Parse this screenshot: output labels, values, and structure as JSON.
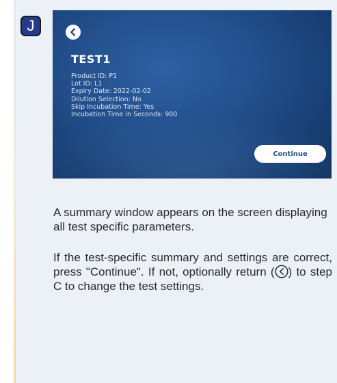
{
  "step": {
    "label": "J"
  },
  "screen": {
    "title": "TEST1",
    "params": [
      "Product ID: P1",
      "Lot ID: L1",
      "Expiry Date: 2022-02-02",
      "Dilution Selection: No",
      "Skip Incubation Time: Yes",
      "Incubation Time in Seconds:  900"
    ],
    "continue_label": "Continue",
    "back_icon": "chevron-left-icon"
  },
  "description": {
    "paragraph1": "A summary window appears on the screen displaying all test specific parameters.",
    "paragraph2_before_icon": "If the test-specific summary and settings are correct, press \"Continue\". If not, optionally return (",
    "paragraph2_after_icon": ") to step C to change the test settings.",
    "inline_icon": "back-circle-icon"
  },
  "colors": {
    "badge": "#253c8e",
    "screen_bg": "#24528f",
    "button_text": "#1f4c8d",
    "panel_bg": "#ecf0f7"
  }
}
